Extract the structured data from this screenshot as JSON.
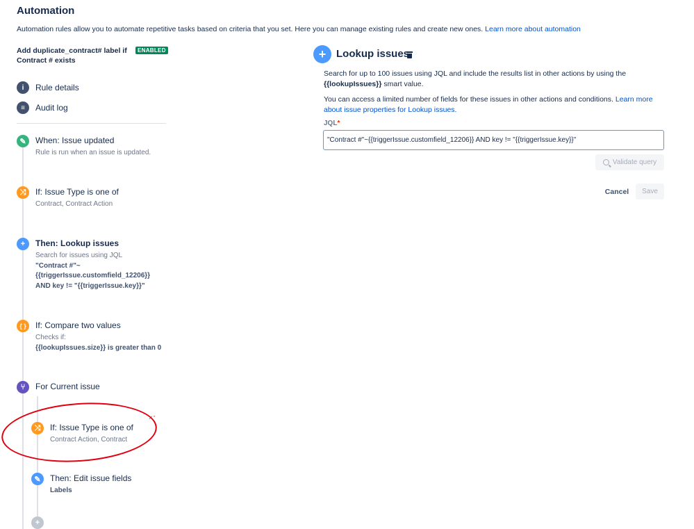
{
  "header": {
    "title": "Automation",
    "intro": "Automation rules allow you to automate repetitive tasks based on criteria that you set. Here you can manage existing rules and create new ones.",
    "learn_more": "Learn more about automation"
  },
  "rule": {
    "name": "Add duplicate_contract# label if Contract # exists",
    "status_badge": "ENABLED"
  },
  "nav": [
    {
      "label": "Rule details",
      "icon": "info-icon"
    },
    {
      "label": "Audit log",
      "icon": "document-icon"
    }
  ],
  "steps": [
    {
      "title": "When: Issue updated",
      "desc": "Rule is run when an issue is updated.",
      "icon": "pencil-icon",
      "color": "#36b37e"
    },
    {
      "title": "If: Issue Type is one of",
      "desc": "Contract, Contract Action",
      "icon": "shuffle-icon",
      "color": "#ff991f"
    },
    {
      "title": "Then: Lookup issues",
      "desc_line1": "Search for issues using JQL",
      "desc_line2": "\"Contract #\"~",
      "desc_line3": "{{triggerIssue.customfield_12206}}",
      "desc_line4": "AND key != \"{{triggerIssue.key}}\"",
      "icon": "plus-icon",
      "color": "#4c9aff"
    },
    {
      "title": "If: Compare two values",
      "desc_line1": "Checks if:",
      "desc_line2": "{{lookupIssues.size}} is greater than 0",
      "icon": "braces-icon",
      "color": "#ff991f"
    },
    {
      "title": "For Current issue",
      "icon": "branch-icon",
      "color": "#6554c0"
    },
    {
      "title": "If: Issue Type is one of",
      "desc": "Contract Action, Contract",
      "icon": "shuffle-icon",
      "color": "#ff991f"
    },
    {
      "title": "Then: Edit issue fields",
      "desc": "Labels",
      "icon": "pencil-icon",
      "color": "#4c9aff"
    }
  ],
  "panel": {
    "title": "Lookup issues",
    "p1_a": "Search for up to 100 issues using JQL and include the results list in other actions by using the",
    "p1_smart": "{{lookupIssues}}",
    "p1_b": "smart value.",
    "p2": "You can access a limited number of fields for these issues in other actions and conditions.",
    "p2_link": "Learn more about issue properties for Lookup issues.",
    "jql_label": "JQL",
    "jql_value": "\"Contract #\"~{{triggerIssue.customfield_12206}} AND key != \"{{triggerIssue.key}}\"",
    "validate_label": "Validate query",
    "cancel_label": "Cancel",
    "save_label": "Save"
  }
}
